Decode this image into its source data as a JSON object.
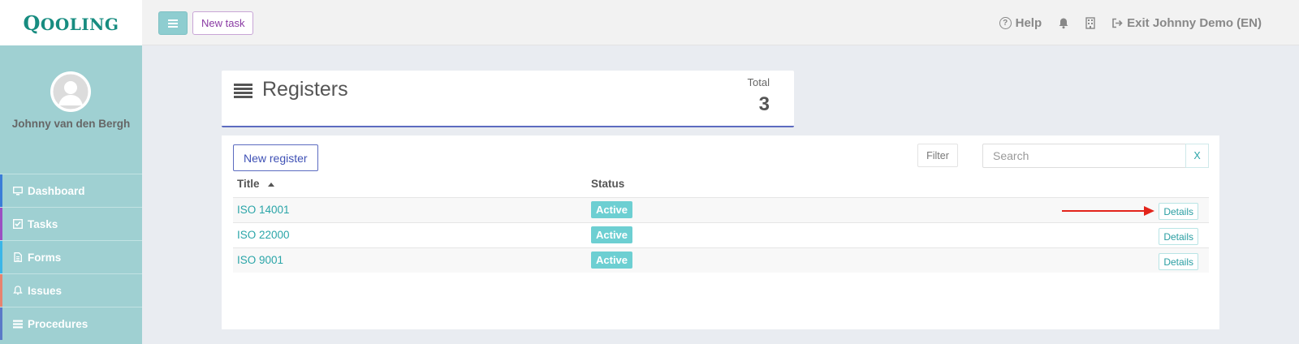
{
  "app": {
    "logo_text": "Qooling"
  },
  "header": {
    "new_task_label": "New task",
    "help_label": "Help",
    "exit_label": "Exit Johnny Demo (EN)"
  },
  "sidebar": {
    "user_name": "Johnny van den Bergh",
    "items": [
      {
        "label": "Dashboard",
        "icon": "monitor-icon",
        "color": "#3b7dd8"
      },
      {
        "label": "Tasks",
        "icon": "check-square-icon",
        "color": "#9b4fc2"
      },
      {
        "label": "Forms",
        "icon": "file-icon",
        "color": "#3ab6e8"
      },
      {
        "label": "Issues",
        "icon": "bell-icon",
        "color": "#e8836f"
      },
      {
        "label": "Procedures",
        "icon": "list-icon",
        "color": "#5a79c8"
      }
    ]
  },
  "registers_card": {
    "title": "Registers",
    "total_label": "Total",
    "total_value": "3"
  },
  "toolbar": {
    "new_register_label": "New register",
    "filter_label": "Filter",
    "search_placeholder": "Search",
    "search_value": "",
    "clear_label": "X"
  },
  "table": {
    "columns": [
      "Title",
      "Status"
    ],
    "rows": [
      {
        "title": "ISO 14001",
        "status": "Active",
        "action": "Details"
      },
      {
        "title": "ISO 22000",
        "status": "Active",
        "action": "Details"
      },
      {
        "title": "ISO 9001",
        "status": "Active",
        "action": "Details"
      }
    ]
  },
  "colors": {
    "accent": "#2aa5a8",
    "sidebar_bg": "#9fd0d2",
    "primary_blue": "#3f51b5",
    "badge_active": "#6dcfd2",
    "annotation_arrow": "#e3241b"
  }
}
